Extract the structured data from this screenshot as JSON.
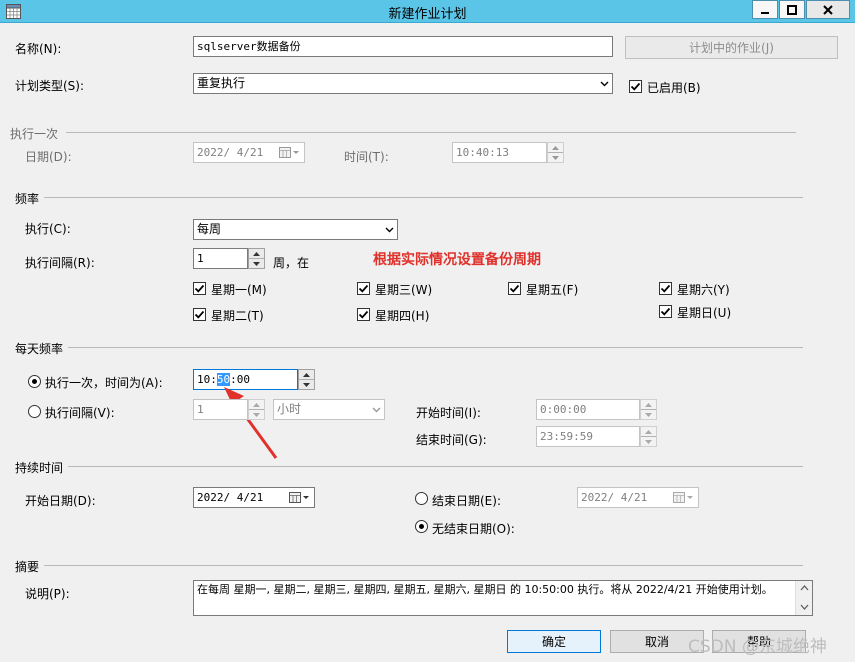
{
  "window": {
    "title": "新建作业计划"
  },
  "fields": {
    "name_label": "名称(N):",
    "name_value": "sqlserver数据备份",
    "jobs_in_schedule_button": "计划中的作业(J)",
    "schedule_type_label": "计划类型(S):",
    "schedule_type_value": "重复执行",
    "enabled_label": "已启用(B)"
  },
  "once": {
    "section": "执行一次",
    "date_label": "日期(D):",
    "date_value": "2022/ 4/21",
    "time_label": "时间(T):",
    "time_value": "10:40:13"
  },
  "frequency": {
    "section": "频率",
    "occurs_label": "执行(C):",
    "occurs_value": "每周",
    "recurs_label": "执行间隔(R):",
    "recurs_value": "1",
    "recurs_unit": "周，在",
    "annotation": "根据实际情况设置备份周期",
    "days": [
      {
        "label": "星期一(M)"
      },
      {
        "label": "星期三(W)"
      },
      {
        "label": "星期五(F)"
      },
      {
        "label": "星期六(Y)"
      },
      {
        "label": "星期二(T)"
      },
      {
        "label": "星期四(H)"
      },
      {
        "label": "星期日(U)"
      }
    ]
  },
  "daily": {
    "section": "每天频率",
    "once_label": "执行一次，时间为(A):",
    "once_time_hh": "10:",
    "once_time_mm": "50",
    "once_time_ss": ":00",
    "every_label": "执行间隔(V):",
    "every_value": "1",
    "every_unit": "小时",
    "start_label": "开始时间(I):",
    "start_value": "0:00:00",
    "end_label": "结束时间(G):",
    "end_value": "23:59:59"
  },
  "duration": {
    "section": "持续时间",
    "start_label": "开始日期(D):",
    "start_value": "2022/ 4/21",
    "end_label": "结束日期(E):",
    "end_value": "2022/ 4/21",
    "no_end_label": "无结束日期(O):"
  },
  "summary": {
    "section": "摘要",
    "desc_label": "说明(P):",
    "desc_value": "在每周 星期一, 星期二, 星期三, 星期四, 星期五, 星期六, 星期日 的 10:50:00 执行。将从 2022/4/21 开始使用计划。"
  },
  "buttons": {
    "ok": "确定",
    "cancel": "取消",
    "help": "帮助"
  },
  "watermark": "CSDN @东城绝神",
  "colors": {
    "titlebar": "#5bc5e8",
    "annotation": "#e0312b",
    "selection": "#3399ff"
  }
}
